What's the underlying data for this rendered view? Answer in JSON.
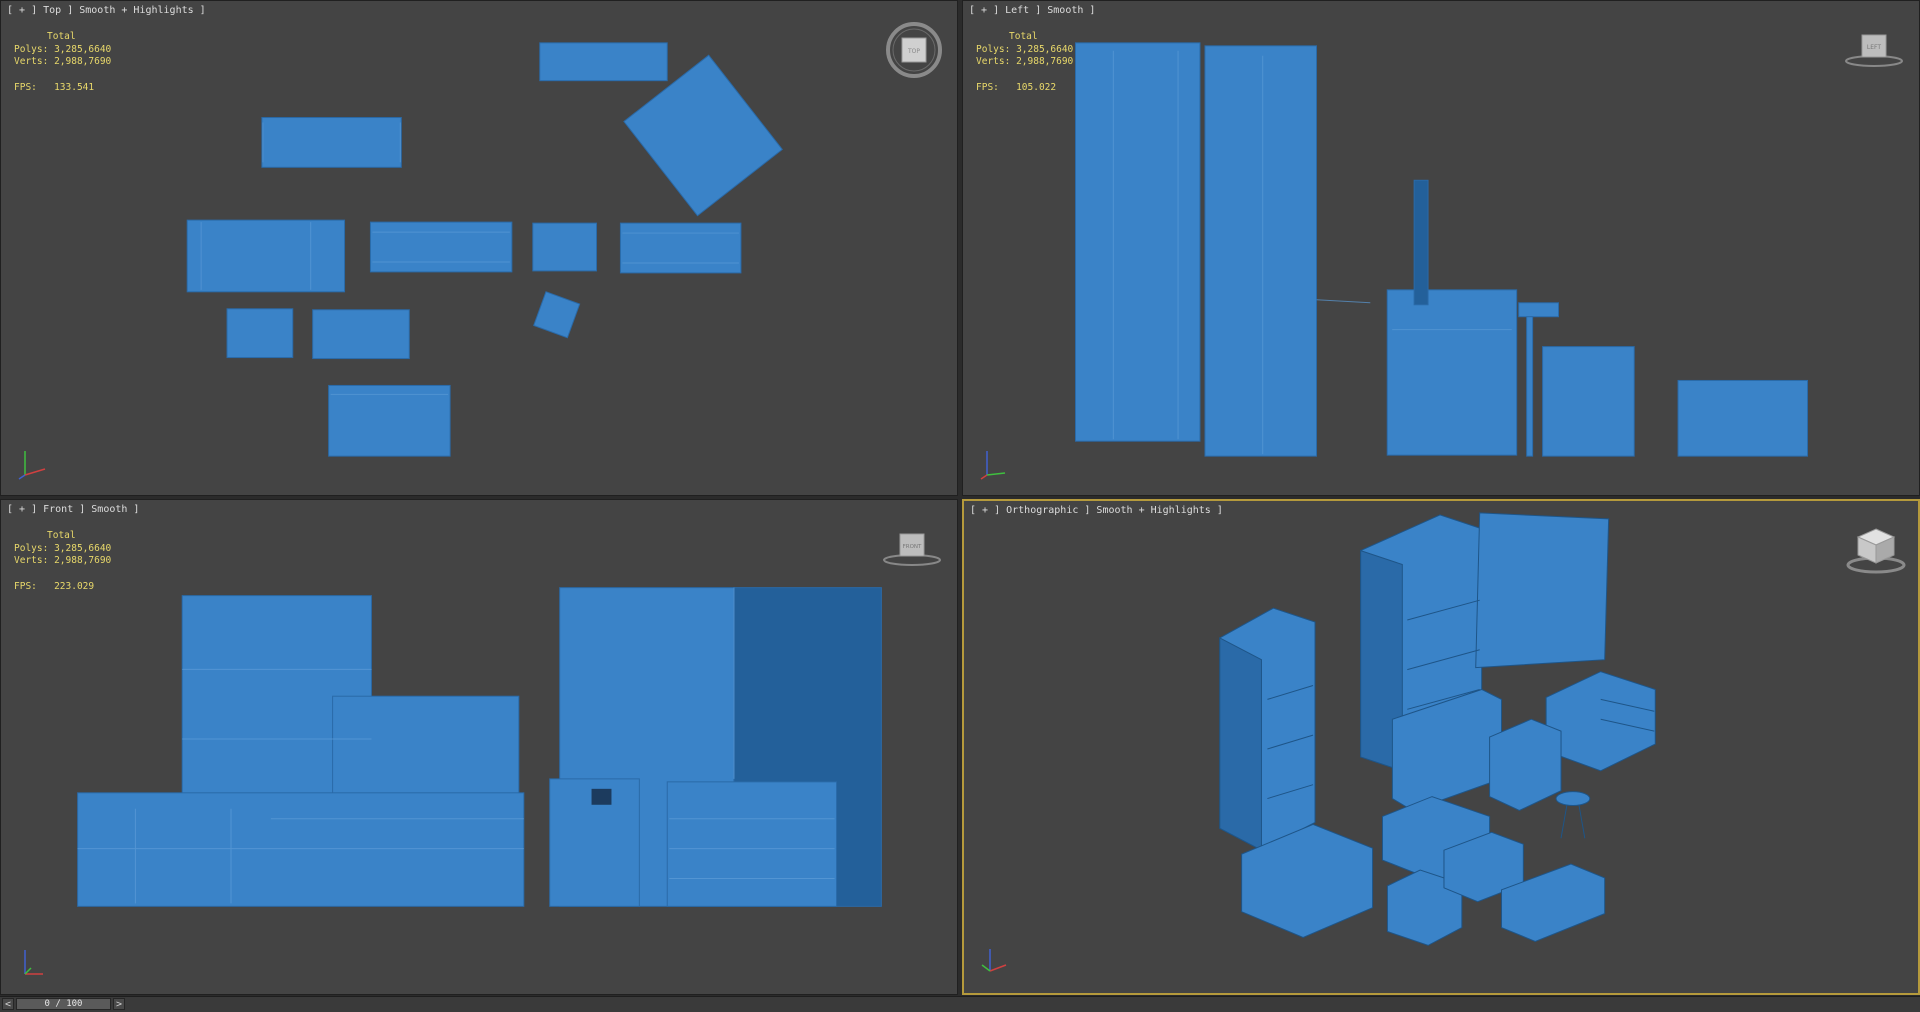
{
  "viewports": {
    "top": {
      "label": "[ + ] Top ] Smooth + Highlights ]",
      "stats": {
        "total": "Total",
        "polys_label": "Polys:",
        "polys": "3,285,6640",
        "verts_label": "Verts:",
        "verts": "2,988,7690",
        "fps_label": "FPS:",
        "fps": "133.541"
      },
      "viewcube": "TOP"
    },
    "left": {
      "label": "[ + ] Left ] Smooth ]",
      "stats": {
        "total": "Total",
        "polys_label": "Polys:",
        "polys": "3,285,6640",
        "verts_label": "Verts:",
        "verts": "2,988,7690",
        "fps_label": "FPS:",
        "fps": "105.022"
      },
      "viewcube": "LEFT"
    },
    "front": {
      "label": "[ + ] Front ] Smooth ]",
      "stats": {
        "total": "Total",
        "polys_label": "Polys:",
        "polys": "3,285,6640",
        "verts_label": "Verts:",
        "verts": "2,988,7690",
        "fps_label": "FPS:",
        "fps": "223.029"
      },
      "viewcube": "FRONT"
    },
    "perspective": {
      "label": "[ + ] Orthographic ] Smooth + Highlights ]",
      "viewcube": ""
    }
  },
  "timebar": {
    "prev": "<",
    "frame": "0 / 100",
    "next": ">"
  },
  "colors": {
    "model": "#3a83c8",
    "model_dark": "#23609a",
    "viewport_bg": "#444444",
    "active_border": "#b59a3c",
    "stats_text": "#e8d86a"
  },
  "icons": {
    "viewcube": "viewcube-icon",
    "axis": "axis-tripod-icon"
  }
}
